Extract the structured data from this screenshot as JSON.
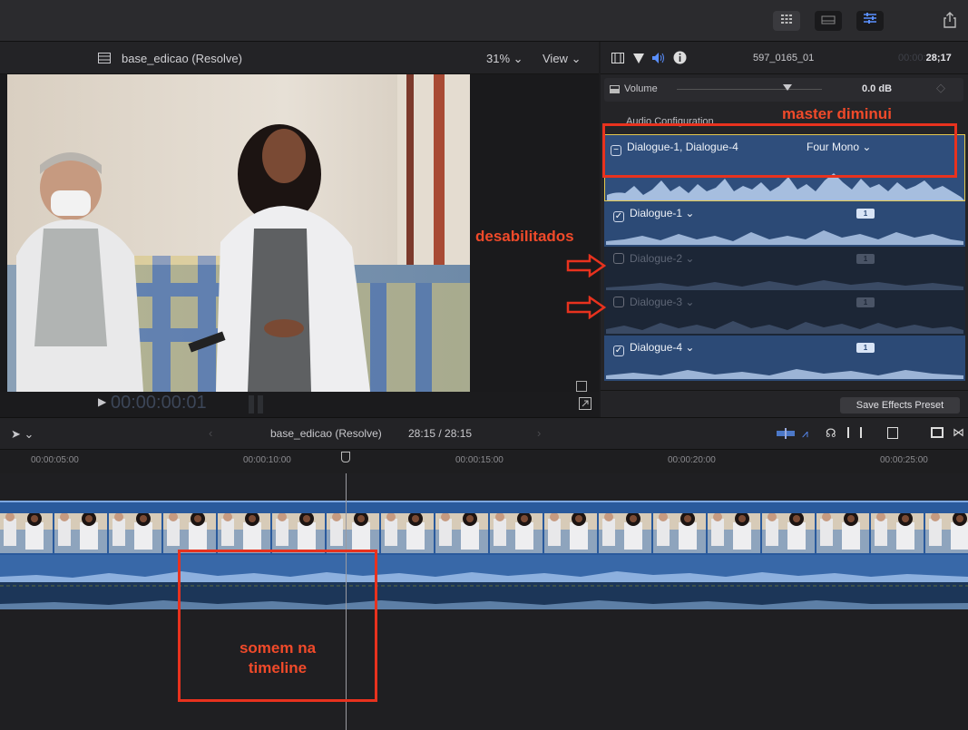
{
  "toolbar": {
    "share_icon": "share-icon"
  },
  "viewer": {
    "clip_title": "base_edicao (Resolve)",
    "zoom": "31%",
    "view_label": "View",
    "timecode": "00:00:00:01"
  },
  "inspector": {
    "clip_name": "597_0165_01",
    "duration_prefix": "00:00:",
    "duration": "28;17",
    "volume_label": "Volume",
    "volume_value": "0.0 dB",
    "audio_config_label": "Audio Configuration",
    "master_row": {
      "label": "Dialogue-1, Dialogue-4",
      "format": "Four Mono"
    },
    "rows": [
      {
        "label": "Dialogue-1",
        "checked": true
      },
      {
        "label": "Dialogue-2",
        "checked": false
      },
      {
        "label": "Dialogue-3",
        "checked": false
      },
      {
        "label": "Dialogue-4",
        "checked": true
      }
    ],
    "badge": "1",
    "save_preset": "Save Effects Preset"
  },
  "timeline": {
    "project": "base_edicao (Resolve)",
    "position": "28:15 / 28:15",
    "ruler": [
      "00:00:05:00",
      "00:00:10:00",
      "00:00:15:00",
      "00:00:20:00",
      "00:00:25:00"
    ]
  },
  "annotations": {
    "master": "master diminui",
    "disabled": "desabilitados",
    "timeline_note_1": "somem na",
    "timeline_note_2": "timeline"
  },
  "colors": {
    "accent": "#4c78c8",
    "annotation": "#e8321e",
    "selection": "#e3c850"
  }
}
